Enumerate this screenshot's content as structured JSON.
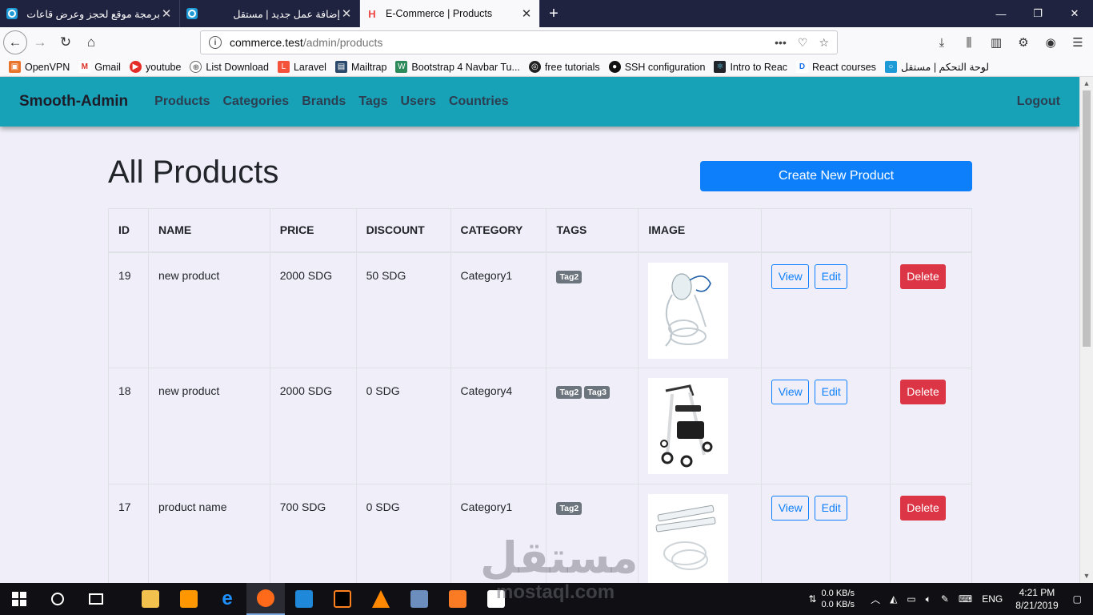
{
  "browser": {
    "tabs": [
      {
        "title": "برمجة موقع لحجز وعرض قاعات الا",
        "active": false
      },
      {
        "title": "إضافة عمل جديد | مستقل",
        "active": false
      },
      {
        "title": "E-Commerce | Products",
        "active": true
      }
    ],
    "url_host": "commerce.test",
    "url_path": "/admin/products",
    "bookmarks": [
      "OpenVPN",
      "Gmail",
      "youtube",
      "List Download",
      "Laravel",
      "Mailtrap",
      "Bootstrap 4 Navbar Tu...",
      "free tutorials",
      "SSH configuration",
      "Intro to Reac",
      "React courses",
      "لوحة التحكم | مستقل"
    ]
  },
  "app": {
    "brand": "Smooth-Admin",
    "menu": [
      "Products",
      "Categories",
      "Brands",
      "Tags",
      "Users",
      "Countries"
    ],
    "logout": "Logout"
  },
  "main": {
    "title": "All Products",
    "create_button": "Create New Product",
    "columns": [
      "ID",
      "NAME",
      "PRICE",
      "DISCOUNT",
      "CATEGORY",
      "TAGS",
      "IMAGE",
      "",
      ""
    ],
    "rows": [
      {
        "id": "19",
        "name": "new product",
        "price": "2000 SDG",
        "discount": "50 SDG",
        "category": "Category1",
        "tags": [
          "Tag2"
        ],
        "image": "oxygen-mask"
      },
      {
        "id": "18",
        "name": "new product",
        "price": "2000 SDG",
        "discount": "0 SDG",
        "category": "Category4",
        "tags": [
          "Tag2",
          "Tag3"
        ],
        "image": "rollator-walker"
      },
      {
        "id": "17",
        "name": "product name",
        "price": "700 SDG",
        "discount": "0 SDG",
        "category": "Category1",
        "tags": [
          "Tag2"
        ],
        "image": "syringes-tubing"
      }
    ],
    "view_label": "View",
    "edit_label": "Edit",
    "delete_label": "Delete"
  },
  "watermark": {
    "arabic": "مستقل",
    "latin": "mostaql.com"
  },
  "taskbar": {
    "net_up": "0.0 KB/s",
    "net_down": "0.0 KB/s",
    "lang": "ENG",
    "time": "4:21 PM",
    "date": "8/21/2019"
  },
  "colors": {
    "navbar": "#17a2b8",
    "primary": "#0d7ffb",
    "danger": "#dc3545",
    "badge": "#6c757d"
  }
}
